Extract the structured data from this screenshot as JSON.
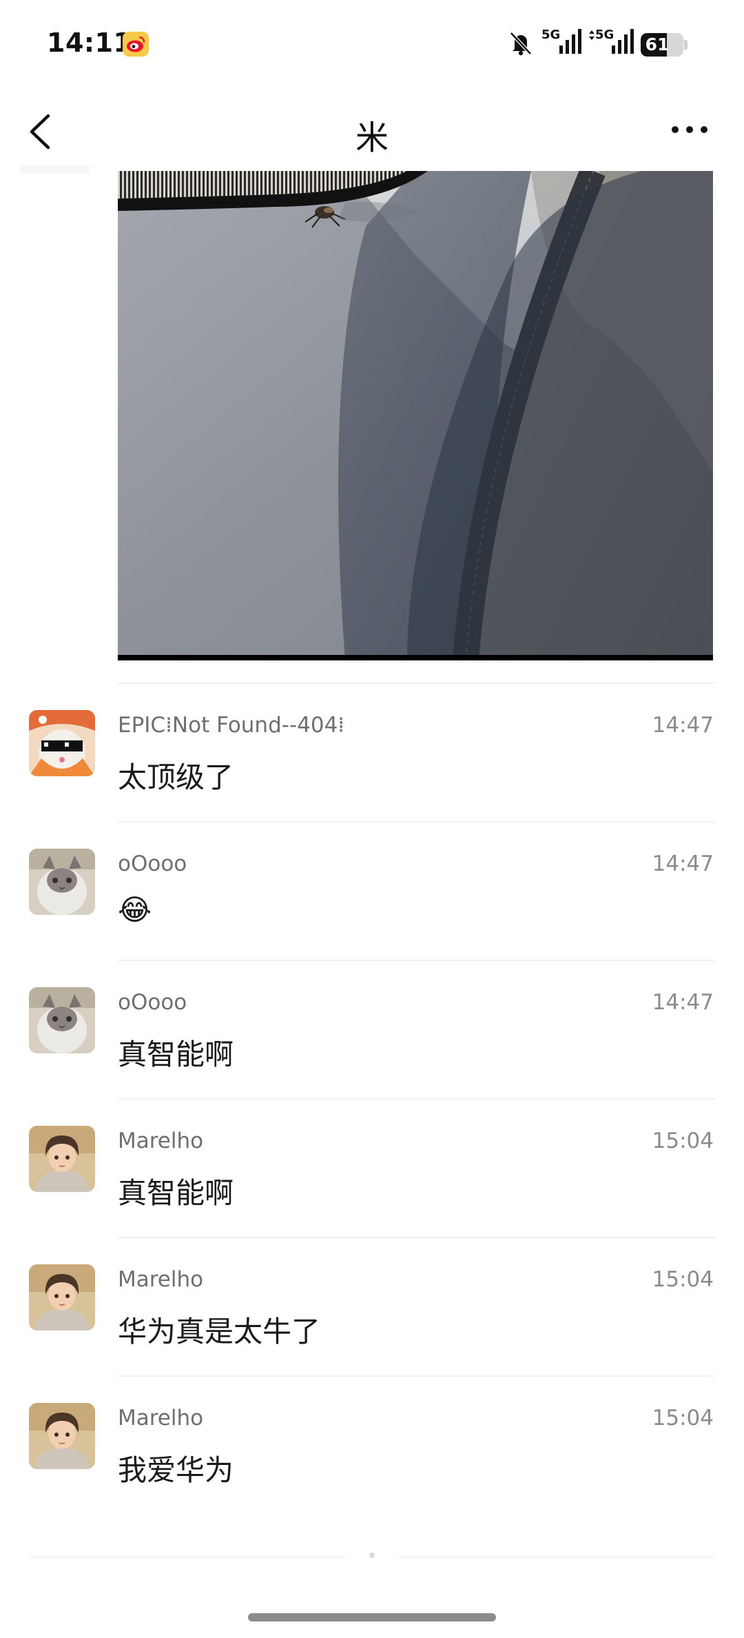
{
  "status_bar": {
    "time": "14:11",
    "network_1": "5G",
    "network_2": "5G",
    "battery_level": "61",
    "battery_fraction": 0.61,
    "icons": [
      "weibo-icon",
      "mute-bell-icon",
      "signal-icon",
      "signal-icon",
      "battery-icon"
    ]
  },
  "nav": {
    "title": "米",
    "back_icon": "chevron-left-icon",
    "more_icon": "more-dots-icon"
  },
  "comments": [
    {
      "user": "EPIC⁞Not Found--404⁞",
      "time": "14:47",
      "text": "太顶级了",
      "avatar": "orange-cat-sunglasses-avatar"
    },
    {
      "user": "oOooo",
      "time": "14:47",
      "text": "😂",
      "avatar": "grey-cat-avatar"
    },
    {
      "user": "oOooo",
      "time": "14:47",
      "text": "真智能啊",
      "avatar": "grey-cat-avatar"
    },
    {
      "user": "Marelho",
      "time": "15:04",
      "text": "真智能啊",
      "avatar": "anime-boy-avatar"
    },
    {
      "user": "Marelho",
      "time": "15:04",
      "text": "华为真是太牛了",
      "avatar": "anime-boy-avatar"
    },
    {
      "user": "Marelho",
      "time": "15:04",
      "text": "我爱华为",
      "avatar": "anime-boy-avatar"
    }
  ],
  "colors": {
    "background": "#ffffff",
    "username": "#6f6f6f",
    "timestamp": "#8b8b8b",
    "text": "#1a1a1a"
  }
}
